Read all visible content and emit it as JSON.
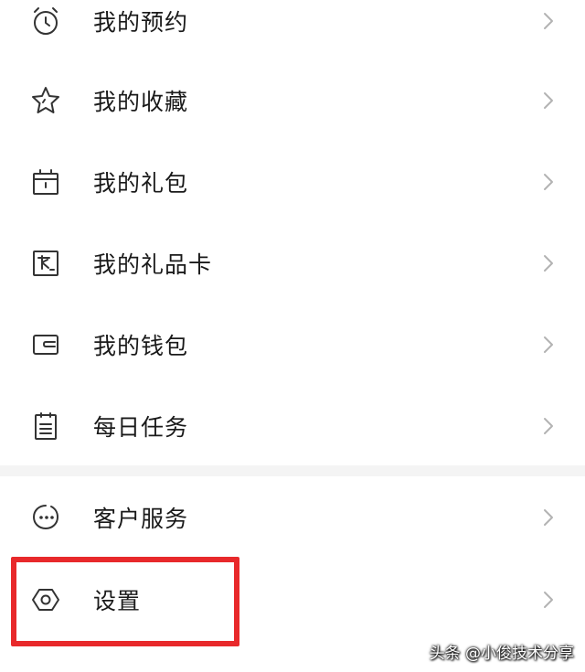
{
  "menu": {
    "items": [
      {
        "label": "我的预约",
        "icon": "alarm-clock-icon"
      },
      {
        "label": "我的收藏",
        "icon": "star-icon"
      },
      {
        "label": "我的礼包",
        "icon": "gift-box-icon"
      },
      {
        "label": "我的礼品卡",
        "icon": "gift-card-icon"
      },
      {
        "label": "我的钱包",
        "icon": "wallet-icon"
      },
      {
        "label": "每日任务",
        "icon": "calendar-task-icon"
      },
      {
        "label": "客户服务",
        "icon": "chat-bubble-icon"
      },
      {
        "label": "设置",
        "icon": "hexagon-gear-icon"
      }
    ]
  },
  "highlight": {
    "color": "#e8292b"
  },
  "watermark": {
    "text": "头条 @小俊技术分享"
  }
}
